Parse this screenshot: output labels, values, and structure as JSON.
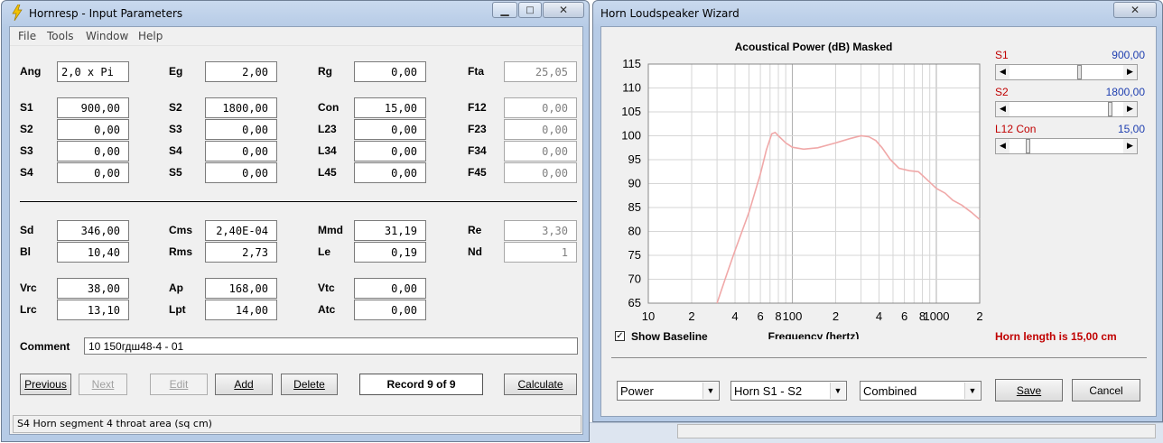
{
  "left_window": {
    "title": "Hornresp - Input Parameters",
    "menu": [
      "File",
      "Tools",
      "Window",
      "Help"
    ],
    "rows": [
      {
        "l1": "Ang",
        "v1": "2,0 x Pi",
        "l2": "Eg",
        "v2": "2,00",
        "l3": "Rg",
        "v3": "0,00",
        "l4": "Fta",
        "v4": "25,05"
      },
      {
        "l1": "S1",
        "v1": "900,00",
        "l2": "S2",
        "v2": "1800,00",
        "l3": "Con",
        "v3": "15,00",
        "l4": "F12",
        "v4": "0,00"
      },
      {
        "l1": "S2",
        "v1": "0,00",
        "l2": "S3",
        "v2": "0,00",
        "l3": "L23",
        "v3": "0,00",
        "l4": "F23",
        "v4": "0,00"
      },
      {
        "l1": "S3",
        "v1": "0,00",
        "l2": "S4",
        "v2": "0,00",
        "l3": "L34",
        "v3": "0,00",
        "l4": "F34",
        "v4": "0,00"
      },
      {
        "l1": "S4",
        "v1": "0,00",
        "l2": "S5",
        "v2": "0,00",
        "l3": "L45",
        "v3": "0,00",
        "l4": "F45",
        "v4": "0,00"
      },
      {
        "l1": "Sd",
        "v1": "346,00",
        "l2": "Cms",
        "v2": "2,40E-04",
        "l3": "Mmd",
        "v3": "31,19",
        "l4": "Re",
        "v4": "3,30"
      },
      {
        "l1": "Bl",
        "v1": "10,40",
        "l2": "Rms",
        "v2": "2,73",
        "l3": "Le",
        "v3": "0,19",
        "l4": "Nd",
        "v4": "1"
      },
      {
        "l1": "Vrc",
        "v1": "38,00",
        "l2": "Ap",
        "v2": "168,00",
        "l3": "Vtc",
        "v3": "0,00"
      },
      {
        "l1": "Lrc",
        "v1": "13,10",
        "l2": "Lpt",
        "v2": "14,00",
        "l3": "Atc",
        "v3": "0,00"
      }
    ],
    "comment_label": "Comment",
    "comment_value": "10 150гдш48-4 - 01",
    "buttons": {
      "previous": "Previous",
      "next": "Next",
      "edit": "Edit",
      "add": "Add",
      "delete": "Delete",
      "calculate": "Calculate"
    },
    "record": "Record 9 of 9",
    "status": "S4   Horn segment 4 throat area  (sq cm)"
  },
  "right_window": {
    "title": "Horn Loudspeaker Wizard",
    "show_baseline": "Show Baseline",
    "horn_length": "Horn length is 15,00 cm",
    "sliders": [
      {
        "label": "S1",
        "value": "900,00",
        "position": 0.62
      },
      {
        "label": "S2",
        "value": "1800,00",
        "position": 0.9
      },
      {
        "label": "L12  Con",
        "value": "15,00",
        "position": 0.15
      }
    ],
    "combos": [
      "Power",
      "Horn S1 - S2",
      "Combined"
    ],
    "buttons": {
      "save": "Save",
      "cancel": "Cancel"
    }
  },
  "chart_data": {
    "type": "line",
    "title": "Acoustical Power (dB)   Masked",
    "xlabel": "Frequency (hertz)",
    "ylabel": "",
    "x_scale": "log",
    "xlim": [
      10,
      2000
    ],
    "ylim": [
      65,
      115
    ],
    "grid": true,
    "line_color": "#f0a8a8",
    "y_ticks": [
      "115",
      "110",
      "105",
      "100",
      "95",
      "90",
      "85",
      "80",
      "75",
      "70",
      "65"
    ],
    "x_ticks": [
      {
        "v": 10,
        "t": "10"
      },
      {
        "v": 20,
        "t": "2"
      },
      {
        "v": 40,
        "t": "4"
      },
      {
        "v": 60,
        "t": "6"
      },
      {
        "v": 80,
        "t": "8"
      },
      {
        "v": 100,
        "t": "100"
      },
      {
        "v": 200,
        "t": "2"
      },
      {
        "v": 400,
        "t": "4"
      },
      {
        "v": 600,
        "t": "6"
      },
      {
        "v": 800,
        "t": "8"
      },
      {
        "v": 1000,
        "t": "1000"
      },
      {
        "v": 2000,
        "t": "2"
      }
    ],
    "series": [
      {
        "x": [
          30,
          35,
          40,
          50,
          60,
          66,
          72,
          76,
          80,
          90,
          100,
          120,
          150,
          200,
          250,
          300,
          340,
          380,
          420,
          480,
          550,
          650,
          750,
          850,
          1000,
          1150,
          1300,
          1500,
          1750,
          2000
        ],
        "y": [
          65,
          71,
          76,
          84,
          92,
          97,
          100.4,
          100.7,
          100,
          98.5,
          97.6,
          97.2,
          97.5,
          98.5,
          99.4,
          100,
          99.8,
          99,
          97.5,
          95,
          93.2,
          92.7,
          92.5,
          91,
          89,
          88,
          86.5,
          85.5,
          84,
          82.5
        ]
      }
    ]
  }
}
